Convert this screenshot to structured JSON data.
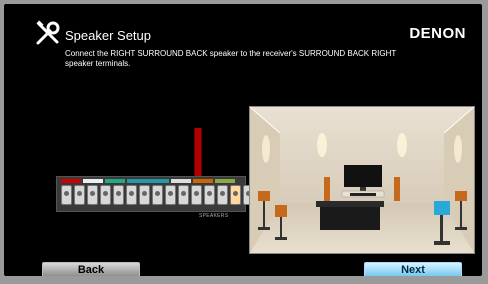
{
  "header": {
    "title": "Speaker Setup",
    "brand": "DENON",
    "icon": "wrench-screwdriver-icon"
  },
  "instruction": "Connect the RIGHT SURROUND BACK speaker to the receiver's SURROUND BACK RIGHT speaker terminals.",
  "receiver": {
    "terminals_label": "SPEAKERS",
    "highlighted_terminal": "SURROUND BACK RIGHT",
    "cable_color": "#b00000"
  },
  "footer": {
    "back_label": "Back",
    "next_label": "Next"
  },
  "colors": {
    "background": "#000000",
    "next_button": "#6ec6f0",
    "back_button": "#a8a8a8"
  }
}
